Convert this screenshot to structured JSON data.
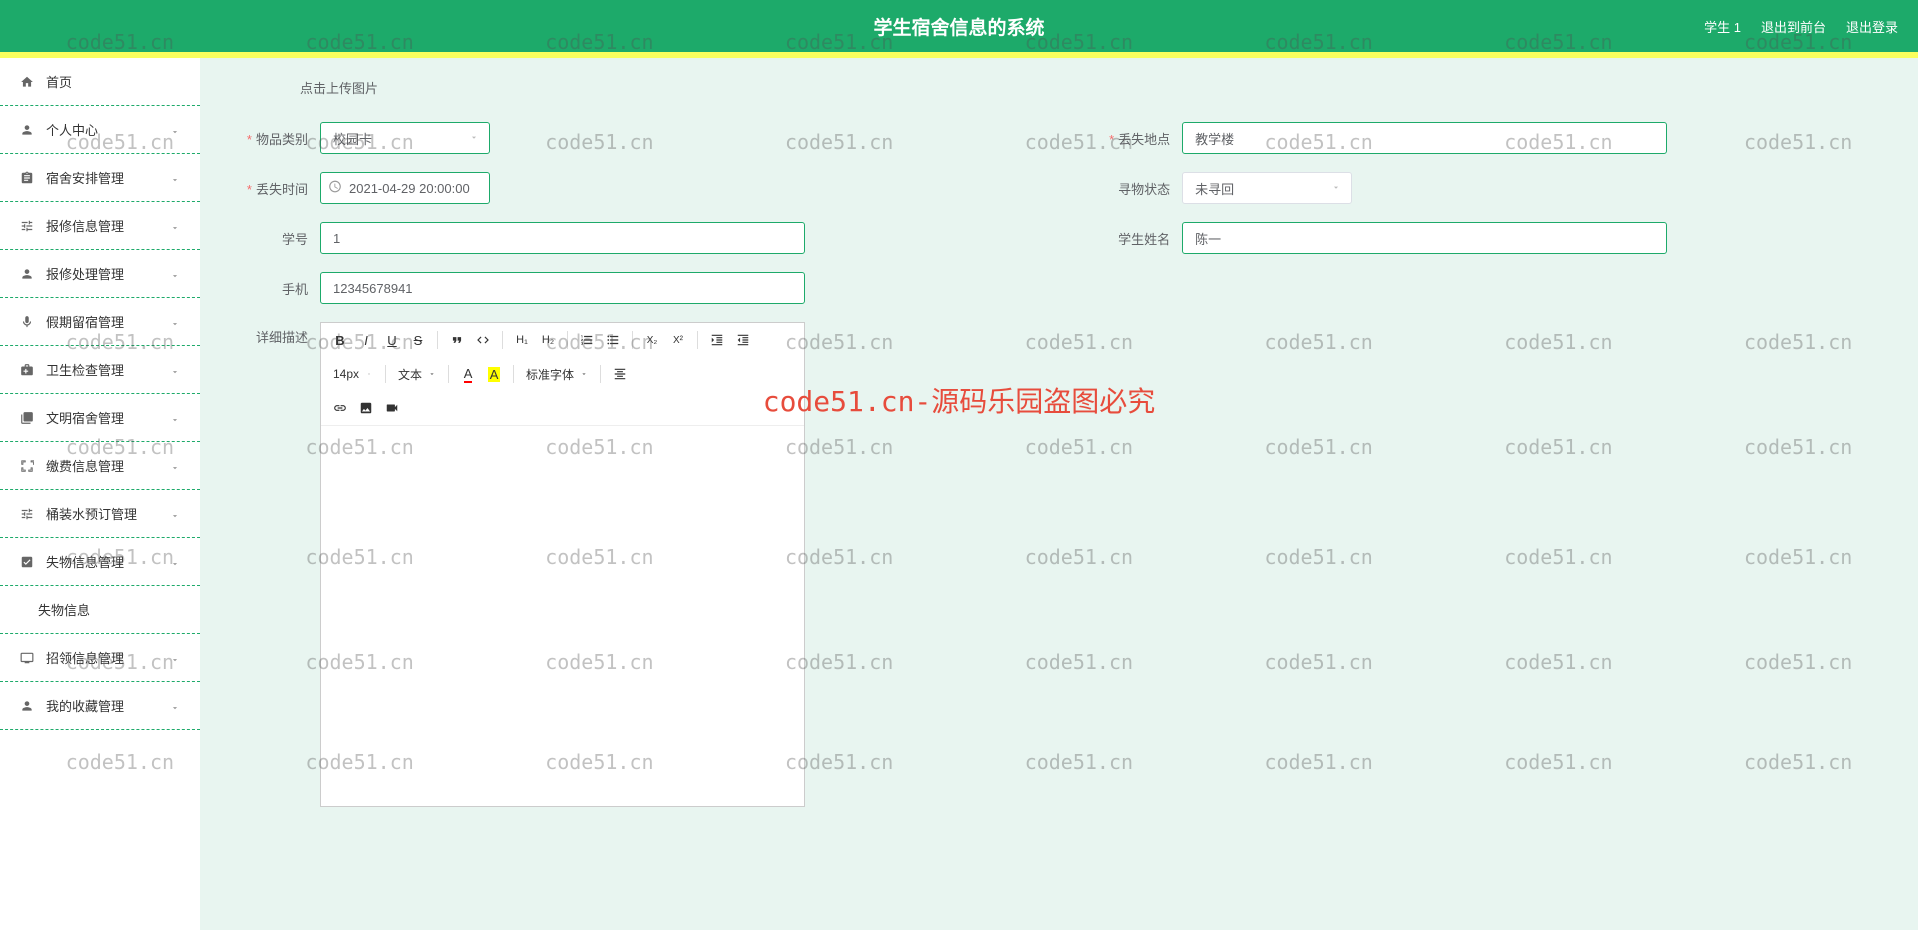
{
  "header": {
    "title": "学生宿舍信息的系统",
    "user": "学生 1",
    "exit_front": "退出到前台",
    "logout": "退出登录"
  },
  "sidebar": {
    "items": [
      {
        "icon": "home",
        "label": "首页",
        "expandable": false
      },
      {
        "icon": "person",
        "label": "个人中心",
        "expandable": true
      },
      {
        "icon": "assignment",
        "label": "宿舍安排管理",
        "expandable": true
      },
      {
        "icon": "tune",
        "label": "报修信息管理",
        "expandable": true
      },
      {
        "icon": "person-check",
        "label": "报修处理管理",
        "expandable": true
      },
      {
        "icon": "mic",
        "label": "假期留宿管理",
        "expandable": true
      },
      {
        "icon": "health",
        "label": "卫生检查管理",
        "expandable": true
      },
      {
        "icon": "library",
        "label": "文明宿舍管理",
        "expandable": true
      },
      {
        "icon": "expand",
        "label": "缴费信息管理",
        "expandable": true
      },
      {
        "icon": "tune",
        "label": "桶装水预订管理",
        "expandable": true
      },
      {
        "icon": "lost",
        "label": "失物信息管理",
        "expandable": true,
        "expanded": true,
        "sub": "失物信息"
      },
      {
        "icon": "display",
        "label": "招领信息管理",
        "expandable": true
      },
      {
        "icon": "favorite",
        "label": "我的收藏管理",
        "expandable": true
      }
    ]
  },
  "form": {
    "upload_hint": "点击上传图片",
    "category_label": "物品类别",
    "category_value": "校园卡",
    "location_label": "丢失地点",
    "location_value": "教学楼",
    "lost_time_label": "丢失时间",
    "lost_time_value": "2021-04-29 20:00:00",
    "status_label": "寻物状态",
    "status_value": "未寻回",
    "student_id_label": "学号",
    "student_id_value": "1",
    "student_name_label": "学生姓名",
    "student_name_value": "陈一",
    "phone_label": "手机",
    "phone_value": "12345678941",
    "description_label": "详细描述"
  },
  "editor": {
    "font_size": "14px",
    "text_type": "文本",
    "font_family": "标准字体"
  },
  "watermark": {
    "main": "code51.cn-源码乐园盗图必究",
    "tile": "code51.cn"
  }
}
